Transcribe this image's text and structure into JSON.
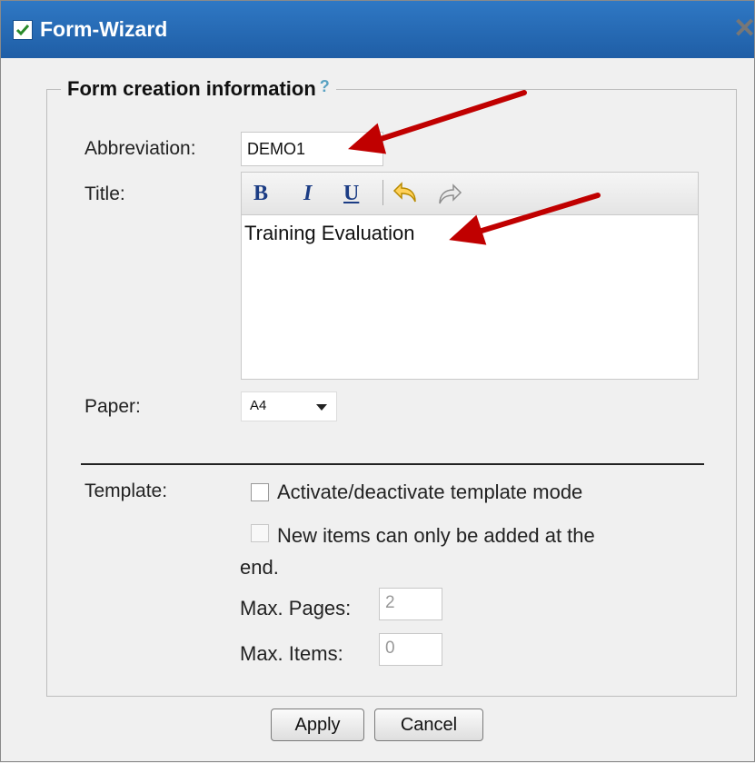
{
  "window": {
    "title": "Form-Wizard",
    "close_icon": "close-icon"
  },
  "section": {
    "legend": "Form creation information",
    "help": "?"
  },
  "fields": {
    "abbreviation_label": "Abbreviation:",
    "abbreviation_value": "DEMO1",
    "title_label": "Title:",
    "title_value": "Training Evaluation",
    "paper_label": "Paper:",
    "paper_value": "A4",
    "template_label": "Template:",
    "template_mode_label": "Activate/deactivate template mode",
    "template_mode_checked": false,
    "append_only_label": "New items can only be added at the end.",
    "append_only_line1": "New items can only be added at the",
    "append_only_line2": "end.",
    "append_only_checked": false,
    "max_pages_label": "Max. Pages:",
    "max_pages_value": "2",
    "max_items_label": "Max. Items:",
    "max_items_value": "0"
  },
  "toolbar": {
    "bold": "B",
    "italic": "I",
    "underline": "U",
    "undo_icon": "undo-icon",
    "redo_icon": "redo-icon"
  },
  "buttons": {
    "apply": "Apply",
    "cancel": "Cancel"
  },
  "colors": {
    "titlebar": "#2f78c4",
    "annotation_arrow": "#c00000",
    "toolbar_text": "#1b3c84"
  }
}
